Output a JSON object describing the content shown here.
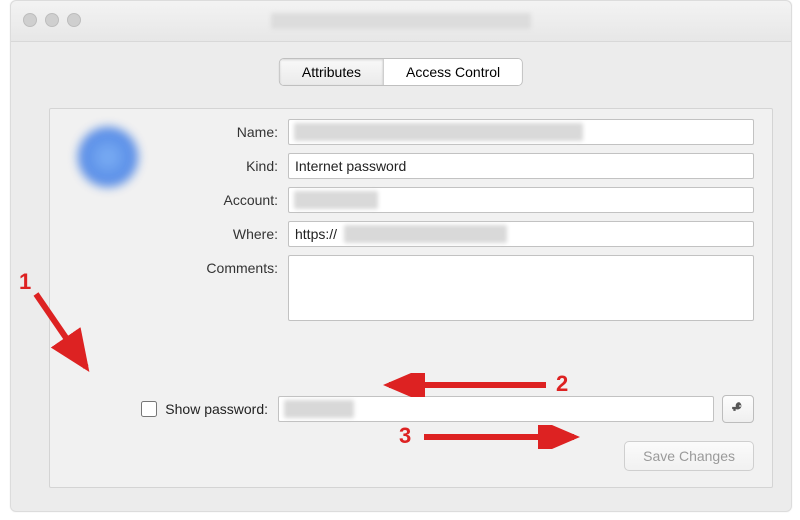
{
  "window": {
    "title_redacted": true
  },
  "tabs": {
    "attributes": "Attributes",
    "access_control": "Access Control",
    "selected": "attributes"
  },
  "form": {
    "name_label": "Name:",
    "name_value": "",
    "kind_label": "Kind:",
    "kind_value": "Internet password",
    "account_label": "Account:",
    "account_value": "",
    "where_label": "Where:",
    "where_value": "https://",
    "comments_label": "Comments:",
    "comments_value": ""
  },
  "password": {
    "show_label": "Show password:",
    "checked": false,
    "value": ""
  },
  "buttons": {
    "save_changes": "Save Changes"
  },
  "annotations": {
    "n1": "1",
    "n2": "2",
    "n3": "3"
  },
  "colors": {
    "annotation": "#d22222",
    "window_bg": "#ececec",
    "panel_bg": "#f1f1f1"
  }
}
